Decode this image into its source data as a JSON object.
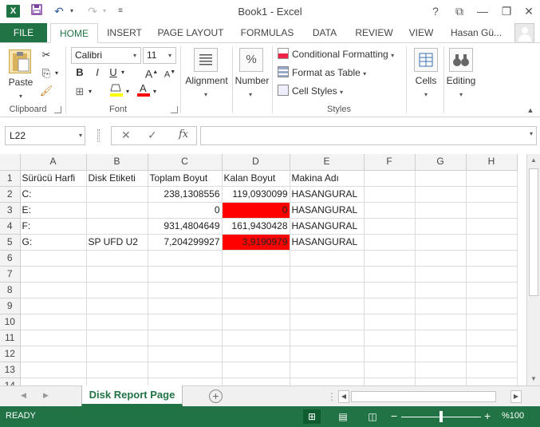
{
  "window": {
    "title": "Book1 - Excel",
    "help": "?",
    "restore": "⧉",
    "minimize": "—",
    "close": "✕"
  },
  "quick_access": {
    "save": "💾",
    "undo": "↶",
    "redo": "↷",
    "customize": "≡"
  },
  "ribbon_tabs": {
    "file": "FILE",
    "items": [
      "HOME",
      "INSERT",
      "PAGE LAYOUT",
      "FORMULAS",
      "DATA",
      "REVIEW",
      "VIEW"
    ],
    "active": "HOME",
    "user": "Hasan Gü..."
  },
  "ribbon": {
    "clipboard": {
      "label": "Clipboard",
      "paste": "Paste"
    },
    "font": {
      "label": "Font",
      "name": "Calibri",
      "size": "11",
      "bold": "B",
      "italic": "I",
      "underline": "U",
      "grow": "A",
      "shrink": "A"
    },
    "alignment": {
      "label": "Alignment"
    },
    "number": {
      "label": "Number",
      "icon": "%"
    },
    "styles": {
      "label": "Styles",
      "conditional": "Conditional Formatting",
      "table": "Format as Table",
      "cell": "Cell Styles"
    },
    "cells": {
      "label": "Cells"
    },
    "editing": {
      "label": "Editing"
    }
  },
  "formula_bar": {
    "name_box": "L22",
    "cancel": "✕",
    "enter": "✓",
    "fx": "fx",
    "value": ""
  },
  "sheet": {
    "columns": [
      "A",
      "B",
      "C",
      "D",
      "E",
      "F",
      "G",
      "H"
    ],
    "rows": [
      [
        "Sürücü Harfi",
        "Disk Etiketi",
        "Toplam Boyut",
        "Kalan Boyut",
        "Makina Adı",
        "",
        "",
        ""
      ],
      [
        "C:",
        "",
        "238,1308556",
        "119,0930099",
        "HASANGURAL",
        "",
        "",
        ""
      ],
      [
        "E:",
        "",
        "0",
        "0",
        "HASANGURAL",
        "",
        "",
        ""
      ],
      [
        "F:",
        "",
        "931,4804649",
        "161,9430428",
        "HASANGURAL",
        "",
        "",
        ""
      ],
      [
        "G:",
        "SP UFD U2",
        "7,204299927",
        "3,9190979",
        "HASANGURAL",
        "",
        "",
        ""
      ],
      [
        "",
        "",
        "",
        "",
        "",
        "",
        "",
        ""
      ],
      [
        "",
        "",
        "",
        "",
        "",
        "",
        "",
        ""
      ],
      [
        "",
        "",
        "",
        "",
        "",
        "",
        "",
        ""
      ],
      [
        "",
        "",
        "",
        "",
        "",
        "",
        "",
        ""
      ],
      [
        "",
        "",
        "",
        "",
        "",
        "",
        "",
        ""
      ],
      [
        "",
        "",
        "",
        "",
        "",
        "",
        "",
        ""
      ],
      [
        "",
        "",
        "",
        "",
        "",
        "",
        "",
        ""
      ],
      [
        "",
        "",
        "",
        "",
        "",
        "",
        "",
        ""
      ],
      [
        "",
        "",
        "",
        "",
        "",
        "",
        "",
        ""
      ]
    ],
    "red_cells": [
      "3-3",
      "5-3"
    ],
    "numeric_cols": [
      2,
      3
    ],
    "highlight_color": "#ff0000"
  },
  "sheet_tabs": {
    "active": "Disk Report Page",
    "add": "+"
  },
  "status": {
    "ready": "READY",
    "zoom": "%100",
    "minus": "−",
    "plus": "+"
  },
  "colors": {
    "excel_green": "#217346",
    "highlight_red": "#ff0000"
  }
}
